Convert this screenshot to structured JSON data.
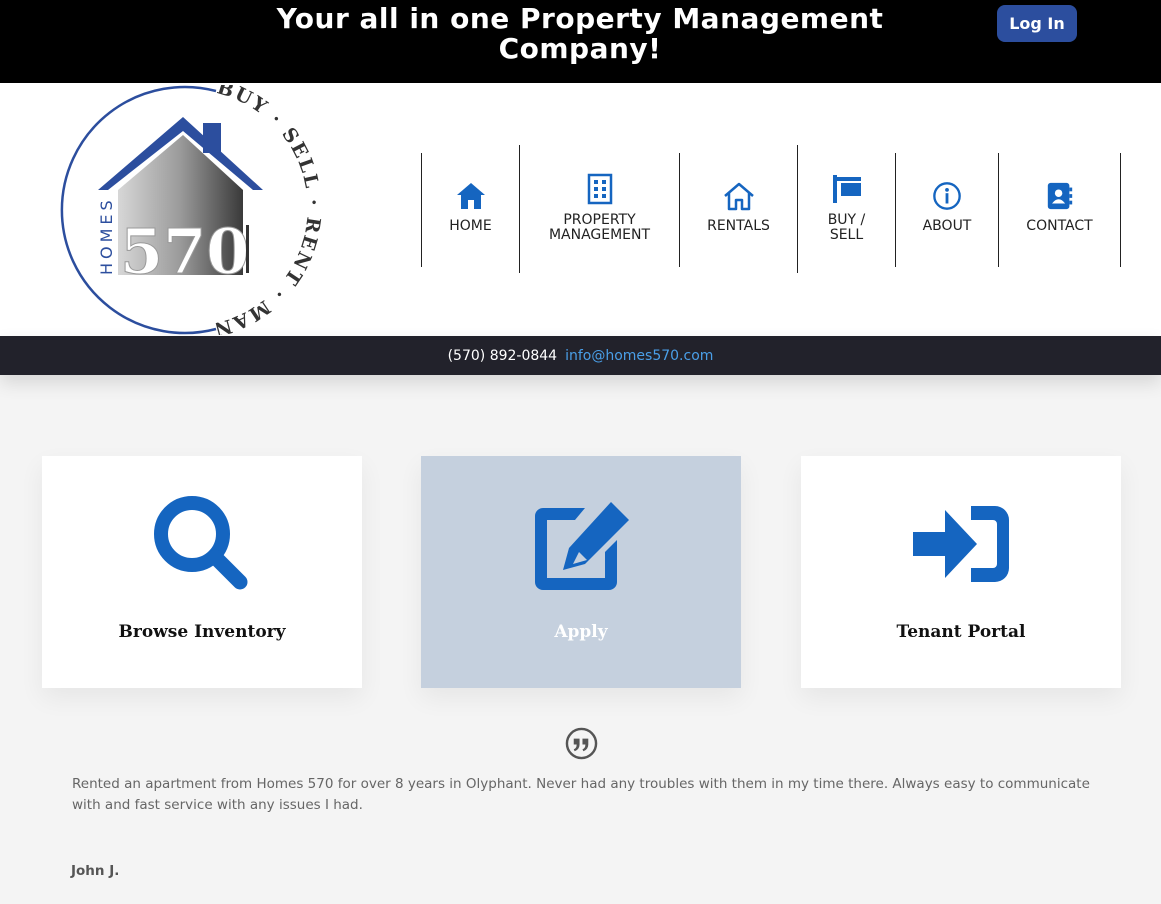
{
  "topbar": {
    "headline_line1": "Your all in one Property Management",
    "headline_line2": "Company!",
    "login_label": "Log In"
  },
  "logo": {
    "text_homes": "HOMES",
    "text_570": "570",
    "ring_text": "BUY · SELL · RENT · MANAGE ·"
  },
  "nav": {
    "items": [
      {
        "label": "HOME",
        "icon": "home-icon"
      },
      {
        "label_line1": "PROPERTY",
        "label_line2": "MANAGEMENT",
        "icon": "building-icon"
      },
      {
        "label": "RENTALS",
        "icon": "house-outline-icon"
      },
      {
        "label_line1": "BUY /",
        "label_line2": "SELL",
        "icon": "sign-icon"
      },
      {
        "label": "ABOUT",
        "icon": "info-icon"
      },
      {
        "label": "CONTACT",
        "icon": "address-book-icon"
      }
    ]
  },
  "strip": {
    "phone": "(570) 892-0844",
    "email": "info@homes570.com"
  },
  "cards": [
    {
      "label": "Browse Inventory",
      "icon": "search-icon"
    },
    {
      "label": "Apply",
      "icon": "edit-icon"
    },
    {
      "label": "Tenant Portal",
      "icon": "sign-in-icon"
    }
  ],
  "testimonial": {
    "text": "Rented an apartment from Homes 570 for over 8 years in Olyphant.  Never had any troubles with them in my time there.  Always easy to communicate with and fast service with any issues I had.",
    "author": "John J."
  },
  "colors": {
    "brand_blue": "#1565c0",
    "login_blue": "#2c4e9e",
    "strip_bg": "#22222b",
    "email_link": "#4a9fe8",
    "apply_card_bg": "#c5d0de"
  }
}
